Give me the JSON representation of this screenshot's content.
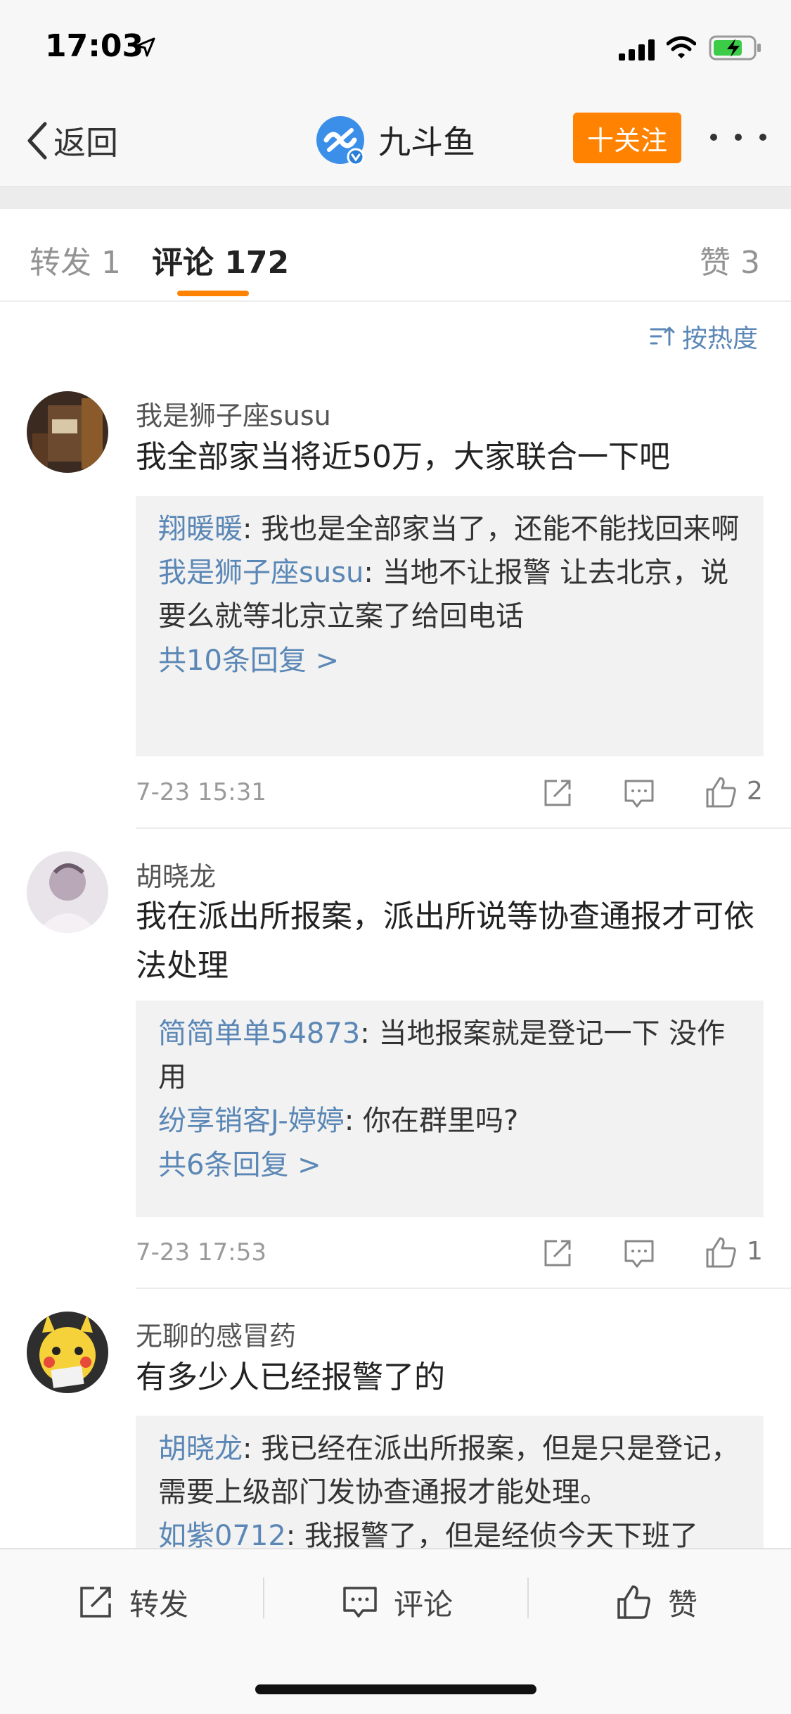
{
  "status_bar": {
    "time": "17:03"
  },
  "nav": {
    "back_label": "返回",
    "account_name": "九斗鱼",
    "follow_label": "十关注"
  },
  "tabs": {
    "repost": "转发 1",
    "comment": "评论 172",
    "like": "赞 3"
  },
  "sort_label": "按热度",
  "comments": [
    {
      "user": "我是狮子座susu",
      "text": "我全部家当将近50万，大家联合一下吧",
      "replies": [
        {
          "name": "翔暖暖",
          "text": ": 我也是全部家当了，还能不能找回来啊"
        },
        {
          "name": "我是狮子座susu",
          "text": ": 当地不让报警 让去北京，说要么就等北京立案了给回电话"
        }
      ],
      "more_replies": "共10条回复 >",
      "time": "7-23 15:31",
      "likes": "2"
    },
    {
      "user": "胡晓龙",
      "text": "我在派出所报案，派出所说等协查通报才可依法处理",
      "replies": [
        {
          "name": "简简单单54873",
          "text": ": 当地报案就是登记一下 没作用"
        },
        {
          "name": "纷享销客J-婷婷",
          "text": ": 你在群里吗?"
        }
      ],
      "more_replies": "共6条回复 >",
      "time": "7-23 17:53",
      "likes": "1"
    },
    {
      "user": "无聊的感冒药",
      "text": "有多少人已经报警了的",
      "replies": [
        {
          "name": "胡晓龙",
          "text": ": 我已经在派出所报案，但是只是登记，需要上级部门发协查通报才能处理。"
        },
        {
          "name": "如紫0712",
          "text": ": 我报警了，但是经侦今天下班了"
        }
      ]
    }
  ],
  "toolbar": {
    "repost": "转发",
    "comment": "评论",
    "like": "赞"
  },
  "colors": {
    "accent": "#ff8200",
    "link": "#5b87b6"
  }
}
